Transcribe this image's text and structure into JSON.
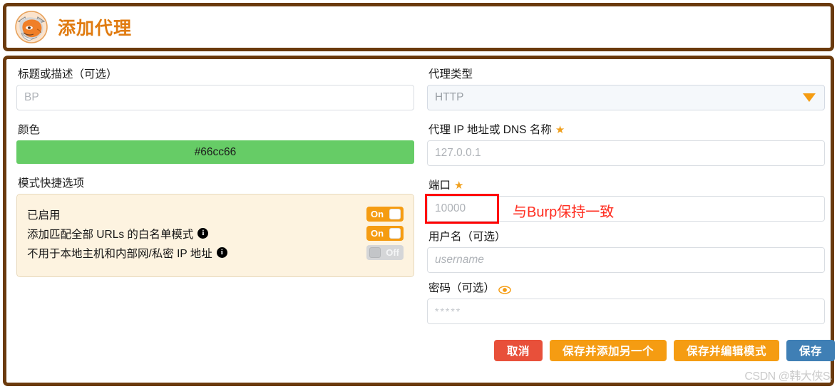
{
  "header": {
    "title": "添加代理",
    "logo_alt": "foxyproxy-logo"
  },
  "left": {
    "title_label": "标题或描述（可选）",
    "title_value": "BP",
    "color_label": "颜色",
    "color_value": "#66cc66",
    "color_hex": "#66cc66",
    "options_label": "模式快捷选项",
    "options": [
      {
        "label": "已启用",
        "has_info": false,
        "state": "On"
      },
      {
        "label": "添加匹配全部 URLs 的白名单模式",
        "has_info": true,
        "state": "On"
      },
      {
        "label": "不用于本地主机和内部网/私密 IP 地址",
        "has_info": true,
        "state": "Off"
      }
    ],
    "toggle_on_text": "On",
    "toggle_off_text": "Off"
  },
  "right": {
    "proxy_type_label": "代理类型",
    "proxy_type_value": "HTTP",
    "host_label": "代理 IP 地址或 DNS 名称",
    "host_placeholder": "127.0.0.1",
    "port_label": "端口",
    "port_placeholder": "10000",
    "port_annotation": "与Burp保持一致",
    "username_label": "用户名（可选）",
    "username_placeholder": "username",
    "password_label": "密码（可选）",
    "password_placeholder": "*****",
    "required_star": "★"
  },
  "buttons": {
    "cancel": "取消",
    "save_and_add_another": "保存并添加另一个",
    "save_and_edit_patterns": "保存并编辑模式",
    "save": "保存"
  },
  "watermark": "CSDN @韩大侠S.",
  "colors": {
    "frame_brown": "#6b3a0d",
    "accent_orange": "#f59c12",
    "title_orange": "#e07b10",
    "cancel_red": "#e8503a",
    "save_blue": "#3f7fb5",
    "annotation_red": "#ff2d20",
    "options_bg": "#fdf3e0"
  }
}
